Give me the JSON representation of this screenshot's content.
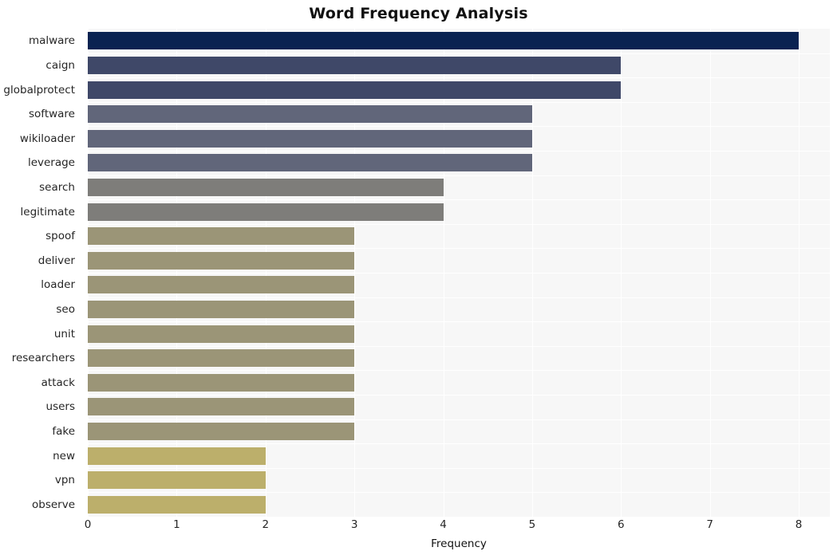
{
  "chart_data": {
    "type": "bar",
    "orientation": "horizontal",
    "title": "Word Frequency Analysis",
    "xlabel": "Frequency",
    "ylabel": "",
    "xlim": [
      0,
      8.35
    ],
    "xticks": [
      0,
      1,
      2,
      3,
      4,
      5,
      6,
      7,
      8
    ],
    "grid": true,
    "legend": null,
    "categories": [
      "malware",
      "caign",
      "globalprotect",
      "software",
      "wikiloader",
      "leverage",
      "search",
      "legitimate",
      "spoof",
      "deliver",
      "loader",
      "seo",
      "unit",
      "researchers",
      "attack",
      "users",
      "fake",
      "new",
      "vpn",
      "observe"
    ],
    "values": [
      8,
      6,
      6,
      5,
      5,
      5,
      4,
      4,
      3,
      3,
      3,
      3,
      3,
      3,
      3,
      3,
      3,
      2,
      2,
      2
    ],
    "bar_colors": [
      "#0a2351",
      "#3f4868",
      "#3f4868",
      "#61667a",
      "#61667a",
      "#61667a",
      "#7e7d7a",
      "#7e7d7a",
      "#9b9577",
      "#9b9577",
      "#9b9577",
      "#9b9577",
      "#9b9577",
      "#9b9577",
      "#9b9577",
      "#9b9577",
      "#9b9577",
      "#bcaf6b",
      "#bcaf6b",
      "#bcaf6b"
    ],
    "plot_background": "#f7f7f7",
    "figure_background": "#ffffff"
  }
}
